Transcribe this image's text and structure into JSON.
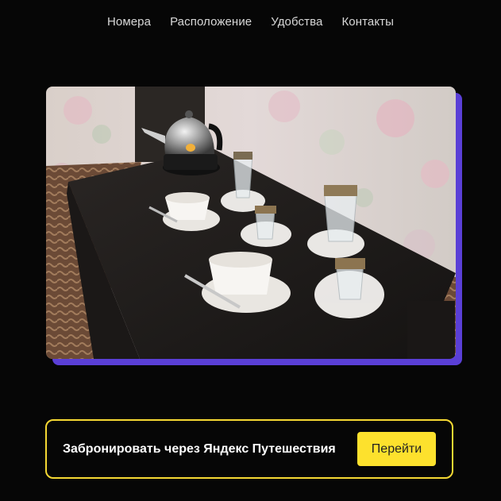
{
  "nav": {
    "items": [
      "Номера",
      "Расположение",
      "Удобства",
      "Контакты"
    ]
  },
  "photo": {
    "alt": "Столик с чайником, чашками и стаканами на салфетках"
  },
  "booking": {
    "text": "Забронировать через Яндекс Путешествия",
    "button_label": "Перейти"
  },
  "colors": {
    "background": "#060606",
    "accent_shadow": "#5a3fd6",
    "booking_border": "#f5d833",
    "button": "#fde12d"
  }
}
